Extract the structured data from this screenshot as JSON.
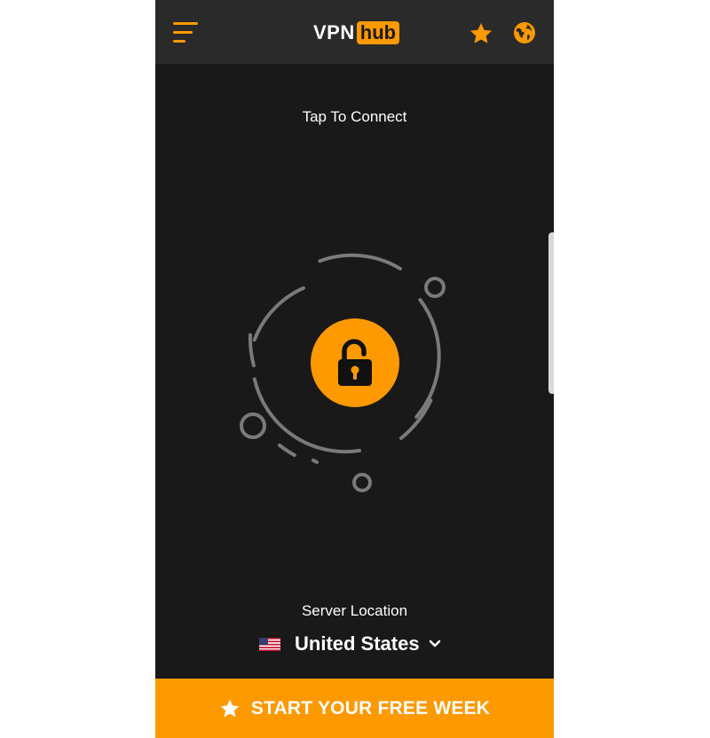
{
  "header": {
    "menu_icon": "menu-icon",
    "logo_left": "VPN",
    "logo_right": "hub",
    "favorites_icon": "star-icon",
    "globe_icon": "globe-icon"
  },
  "main": {
    "status_text": "Tap To Connect",
    "connect_icon": "unlocked-padlock-icon"
  },
  "server": {
    "label": "Server Location",
    "country": "United States",
    "flag_icon": "us-flag-icon",
    "dropdown_icon": "chevron-down-icon"
  },
  "cta": {
    "label": "START YOUR FREE WEEK",
    "icon": "star-icon"
  },
  "colors": {
    "accent": "#ff9900",
    "background": "#191919",
    "header": "#2a2a2a",
    "orbit": "#7a7a7a",
    "text": "#ffffff"
  }
}
